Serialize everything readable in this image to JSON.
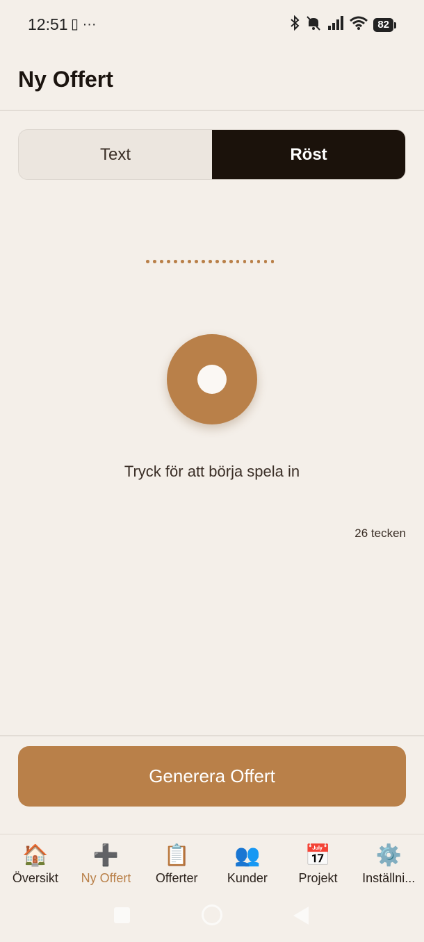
{
  "status_bar": {
    "time": "12:51",
    "left_icons": "▯ ···",
    "battery": "82"
  },
  "header": {
    "title": "Ny Offert"
  },
  "mode_toggle": {
    "segments": [
      {
        "label": "Text",
        "active": false
      },
      {
        "label": "Röst",
        "active": true
      }
    ]
  },
  "recorder": {
    "hint": "Tryck för att börja spela in",
    "char_count": "26 tecken"
  },
  "actions": {
    "generate_label": "Generera Offert"
  },
  "tabs": [
    {
      "label": "Översikt",
      "icon": "🏠",
      "icon_name": "house-icon",
      "active": false
    },
    {
      "label": "Ny Offert",
      "icon": "➕",
      "icon_name": "plus-icon",
      "active": true
    },
    {
      "label": "Offerter",
      "icon": "📋",
      "icon_name": "clipboard-icon",
      "active": false
    },
    {
      "label": "Kunder",
      "icon": "👥",
      "icon_name": "users-icon",
      "active": false
    },
    {
      "label": "Projekt",
      "icon": "📅",
      "icon_name": "calendar-icon",
      "active": false
    },
    {
      "label": "Inställni...",
      "icon": "⚙️",
      "icon_name": "gear-icon",
      "active": false
    }
  ],
  "colors": {
    "background": "#f4efe9",
    "accent": "#b98049",
    "active_segment": "#1b120b"
  }
}
